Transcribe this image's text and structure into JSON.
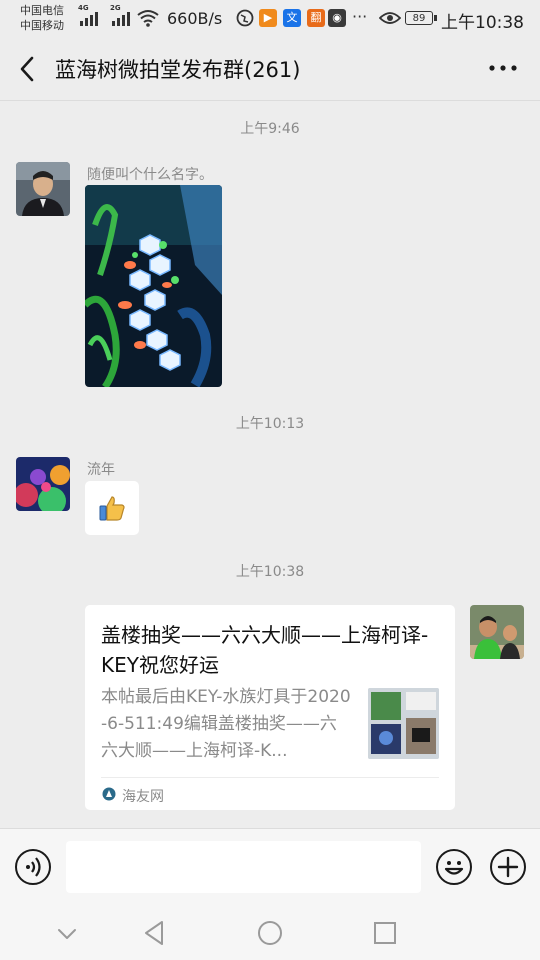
{
  "status_bar": {
    "carrier_1": "中国电信",
    "carrier_2": "中国移动",
    "net_1": "4G",
    "net_2": "2G",
    "speed": "660B/s",
    "more": "···",
    "battery": "89",
    "time": "上午10:38"
  },
  "header": {
    "title": "蓝海树微拍堂发布群(261)"
  },
  "messages": {
    "time_1": "上午9:46",
    "sender_1": "随便叫个什么名字。",
    "time_2": "上午10:13",
    "sender_2": "流年",
    "time_3": "上午10:38",
    "card": {
      "title": "盖楼抽奖——六六大顺——上海柯译-KEY祝您好运",
      "desc": "本帖最后由KEY-水族灯具于2020-6-511:49编辑盖楼抽奖——六六大顺——上海柯译-K...",
      "source": "海友网"
    }
  },
  "input_bar": {
    "placeholder": ""
  }
}
